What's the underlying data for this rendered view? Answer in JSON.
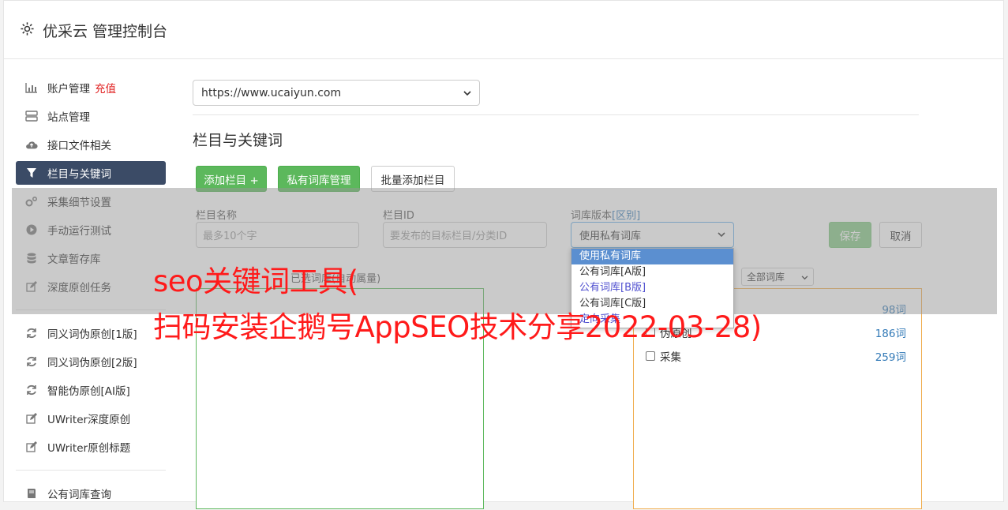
{
  "header": {
    "title": "优采云 管理控制台",
    "icon": "gear-icon"
  },
  "sidebar": {
    "items": [
      {
        "label": "账户管理",
        "badge": "充值",
        "icon": "bar-chart-icon"
      },
      {
        "label": "站点管理",
        "icon": "server-icon"
      },
      {
        "label": "接口文件相关",
        "icon": "cloud-upload-icon"
      },
      {
        "label": "栏目与关键词",
        "icon": "filter-icon",
        "active": true
      },
      {
        "label": "采集细节设置",
        "icon": "cogs-icon"
      },
      {
        "label": "手动运行测试",
        "icon": "play-circle-icon"
      },
      {
        "label": "文章暂存库",
        "icon": "database-icon"
      },
      {
        "label": "深度原创任务",
        "icon": "edit-icon"
      }
    ],
    "items2": [
      {
        "label": "同义词伪原创[1版]",
        "icon": "refresh-icon"
      },
      {
        "label": "同义词伪原创[2版]",
        "icon": "refresh-icon"
      },
      {
        "label": "智能伪原创[AI版]",
        "icon": "refresh-icon"
      },
      {
        "label": "UWriter深度原创",
        "icon": "edit-icon"
      },
      {
        "label": "UWriter原创标题",
        "icon": "edit-icon"
      }
    ],
    "items3": [
      {
        "label": "公有词库查询",
        "icon": "book-icon"
      }
    ]
  },
  "main": {
    "site_select": "https://www.ucaiyun.com",
    "section_title": "栏目与关键词",
    "buttons": {
      "add_column": "添加栏目 +",
      "private_lib": "私有词库管理",
      "batch_add": "批量添加栏目"
    },
    "form": {
      "name_label": "栏目名称",
      "name_placeholder": "最多10个字",
      "id_label": "栏目ID",
      "id_placeholder": "要发布的目标栏目/分类ID",
      "lib_label": "词库版本",
      "lib_label_link": "[区别]",
      "lib_value": "使用私有词库",
      "save": "保存",
      "cancel": "取消"
    },
    "dropdown_options": [
      "使用私有词库",
      "公有词库[A版]",
      "公有词库[B版]",
      "公有词库[C版]",
      "定向采集"
    ],
    "left_panel_label": "已选词库(自动属量)",
    "lib_filter": "全部词库",
    "libraries": [
      {
        "name": "",
        "count": "98词"
      },
      {
        "name": "伪原创",
        "count": "186词"
      },
      {
        "name": "采集",
        "count": "259词"
      }
    ]
  },
  "watermark": {
    "line1": "seo关键词工具(",
    "line2": "扫码安装企鹅号AppSEO技术分享2022-03-28)"
  },
  "colors": {
    "accent_green": "#5cb85c",
    "active_nav": "#3b4b66",
    "watermark": "#ff1a1a",
    "link_blue": "#337ab7"
  }
}
